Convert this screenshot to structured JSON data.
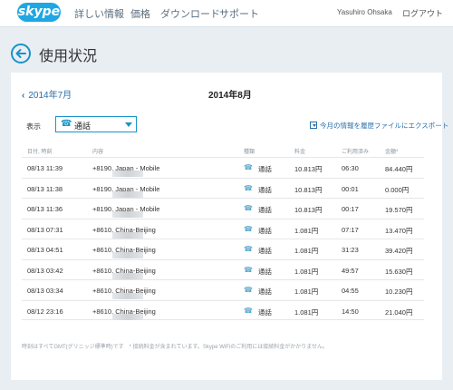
{
  "header": {
    "logo": "skype",
    "nav": [
      "詳しい情報",
      "価格",
      "ダウンロード",
      "サポート"
    ],
    "user": "Yasuhiro Ohsaka",
    "logout": "ログアウト"
  },
  "page": {
    "title": "使用状況"
  },
  "months": {
    "prev": "2014年7月",
    "current": "2014年8月"
  },
  "filter": {
    "label": "表示",
    "selected": "通話"
  },
  "export_label": "今月の情報を履歴ファイルにエクスポート",
  "table": {
    "headers": [
      "日付, 時刻",
      "内容",
      "種類",
      "料金",
      "ご利用済み",
      "金額*"
    ],
    "rows": [
      {
        "datetime": "08/13 11:39",
        "number": "+8190",
        "destination": ", Japan - Mobile",
        "type": "通話",
        "rate": "10.813円",
        "duration": "06:30",
        "amount": "84.440円"
      },
      {
        "datetime": "08/13 11:38",
        "number": "+8190",
        "destination": ", Japan - Mobile",
        "type": "通話",
        "rate": "10.813円",
        "duration": "00:01",
        "amount": "0.000円"
      },
      {
        "datetime": "08/13 11:36",
        "number": "+8190",
        "destination": ", Japan - Mobile",
        "type": "通話",
        "rate": "10.813円",
        "duration": "00:17",
        "amount": "19.570円"
      },
      {
        "datetime": "08/13 07:31",
        "number": "+8610",
        "destination": ", China-Beijing",
        "type": "通話",
        "rate": "1.081円",
        "duration": "07:17",
        "amount": "13.470円"
      },
      {
        "datetime": "08/13 04:51",
        "number": "+8610",
        "destination": ", China-Beijing",
        "type": "通話",
        "rate": "1.081円",
        "duration": "31:23",
        "amount": "39.420円"
      },
      {
        "datetime": "08/13 03:42",
        "number": "+8610",
        "destination": ", China-Beijing",
        "type": "通話",
        "rate": "1.081円",
        "duration": "49:57",
        "amount": "15.630円"
      },
      {
        "datetime": "08/13 03:34",
        "number": "+8610",
        "destination": ", China-Beijing",
        "type": "通話",
        "rate": "1.081円",
        "duration": "04:55",
        "amount": "10.230円"
      },
      {
        "datetime": "08/12 23:16",
        "number": "+8610",
        "destination": ", China-Beijing",
        "type": "通話",
        "rate": "1.081円",
        "duration": "14:50",
        "amount": "21.040円"
      }
    ]
  },
  "footnote": "時刻はすべてGMT(グリニッジ標準時)です　* 接続料金が含まれています。Skype WiFiのご利用には接続料金がかかりません。",
  "colors": {
    "accent": "#1a93c9",
    "link": "#2a6fa8",
    "page_bg": "#e9eef3"
  },
  "icons": {
    "back": "back-arrow-icon",
    "phone": "phone-icon",
    "export": "export-icon",
    "dropdown": "chevron-down-icon"
  }
}
